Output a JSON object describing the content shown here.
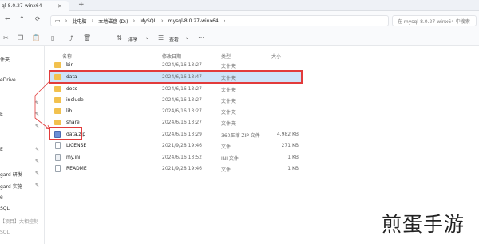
{
  "window": {
    "tab_title": "ql-8.0.27-winx64",
    "close_glyph": "✕",
    "new_tab_glyph": "+"
  },
  "nav": {
    "breadcrumbs": [
      "此电脑",
      "本地磁盘 (D:)",
      "MySQL",
      "mysql-8.0.27-winx64"
    ],
    "search_placeholder": "在 mysql-8.0.27-winx64 中搜索"
  },
  "toolbar": {
    "sort_label": "排序",
    "view_label": "查看"
  },
  "sidebar": {
    "items": [
      {
        "label": "件夹",
        "dim": false
      },
      {
        "label": "eDrive",
        "dim": false
      },
      {
        "label": "",
        "dim": false
      },
      {
        "label": "E",
        "dim": false
      },
      {
        "label": "",
        "dim": false
      },
      {
        "label": "E",
        "dim": false
      },
      {
        "label": "",
        "dim": false
      },
      {
        "label": "gard-研发",
        "dim": false
      },
      {
        "label": "gard-实施",
        "dim": false
      },
      {
        "label": "e",
        "dim": false
      },
      {
        "label": "SQL",
        "dim": false
      },
      {
        "label": "【项目】大相控制",
        "dim": true
      },
      {
        "label": "SQL",
        "dim": true
      }
    ]
  },
  "columns": {
    "name": "名称",
    "date": "修改日期",
    "type": "类型",
    "size": "大小"
  },
  "files": [
    {
      "name": "bin",
      "date": "2024/6/16 13:27",
      "type": "文件夹",
      "size": "",
      "kind": "folder"
    },
    {
      "name": "data",
      "date": "2024/6/16 13:47",
      "type": "文件夹",
      "size": "",
      "kind": "folder"
    },
    {
      "name": "docs",
      "date": "2024/6/16 13:27",
      "type": "文件夹",
      "size": "",
      "kind": "folder"
    },
    {
      "name": "include",
      "date": "2024/6/16 13:27",
      "type": "文件夹",
      "size": "",
      "kind": "folder"
    },
    {
      "name": "lib",
      "date": "2024/6/16 13:27",
      "type": "文件夹",
      "size": "",
      "kind": "folder"
    },
    {
      "name": "share",
      "date": "2024/6/16 13:27",
      "type": "文件夹",
      "size": "",
      "kind": "folder"
    },
    {
      "name": "data.zip",
      "date": "2024/6/16 13:29",
      "type": "360压缩 ZIP 文件",
      "size": "4,982 KB",
      "kind": "zip"
    },
    {
      "name": "LICENSE",
      "date": "2021/9/28 19:46",
      "type": "文件",
      "size": "271 KB",
      "kind": "file"
    },
    {
      "name": "my.ini",
      "date": "2024/6/16 13:52",
      "type": "INI 文件",
      "size": "1 KB",
      "kind": "ini"
    },
    {
      "name": "README",
      "date": "2021/9/28 19:46",
      "type": "文件",
      "size": "1 KB",
      "kind": "file"
    }
  ],
  "watermark": "煎蛋手游",
  "colors": {
    "highlight": "#e23b3b",
    "folder": "#f2c14e",
    "selected_row": "#cfe3f8"
  }
}
